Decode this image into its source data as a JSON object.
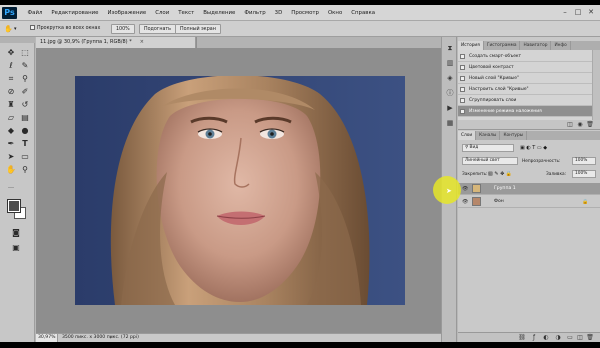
{
  "app": {
    "logo": "Ps"
  },
  "menu": [
    "Файл",
    "Редактирование",
    "Изображение",
    "Слои",
    "Текст",
    "Выделение",
    "Фильтр",
    "3D",
    "Просмотр",
    "Окно",
    "Справка"
  ],
  "window_controls": [
    "–",
    "□",
    "✕"
  ],
  "options": {
    "scroll_all_label": "Прокрутка во всех окнах",
    "zoom_value": "100%",
    "fit_button": "Подогнать",
    "fullscreen_button": "Полный экран"
  },
  "document": {
    "tab_title": "11.jpg @ 30,9% (Группа 1, RGB/8) *",
    "close_glyph": "×",
    "zoom": "30,97%",
    "info": "3500 пикс. x 3000 пикс. (72 ppi)",
    "info_arrow": "›"
  },
  "history_panel": {
    "tabs": [
      "История",
      "Гистограмма",
      "Навигатор",
      "Инфо"
    ],
    "items": [
      "Создать смарт-объект",
      "Цветовой контраст",
      "Новый слой \"Кривые\"",
      "Настроить слой \"Кривые\"",
      "Сгруппировать слои",
      "Изменение режима наложения"
    ],
    "selected_index": 5
  },
  "layers_panel": {
    "tabs": [
      "Слои",
      "Каналы",
      "Контуры"
    ],
    "filter_label": "Вид",
    "blend_mode": "Линейный свет",
    "opacity_label": "Непрозрачность:",
    "opacity_value": "100%",
    "lock_label": "Закрепить:",
    "fill_label": "Заливка:",
    "fill_value": "100%",
    "layers": [
      {
        "name": "Группа 1",
        "selected": true
      },
      {
        "name": "Фон",
        "locked": true
      }
    ]
  },
  "colors": {
    "foreground": "#4d4d4d",
    "background": "#ffffff",
    "cursor_highlight": "#e6e628",
    "backdrop": "#344777"
  },
  "icons": {
    "tools": [
      "move-icon",
      "marquee-icon",
      "lasso-icon",
      "quick-select-icon",
      "crop-icon",
      "eyedropper-icon",
      "healing-brush-icon",
      "brush-icon",
      "clone-stamp-icon",
      "history-brush-icon",
      "eraser-icon",
      "gradient-icon",
      "blur-icon",
      "dodge-icon",
      "pen-icon",
      "type-icon",
      "path-select-icon",
      "rectangle-icon",
      "hand-icon",
      "zoom-icon"
    ],
    "panel_strip": [
      "history-icon",
      "histogram-icon",
      "navigator-icon",
      "info-icon",
      "play-icon",
      "actions-icon"
    ]
  }
}
